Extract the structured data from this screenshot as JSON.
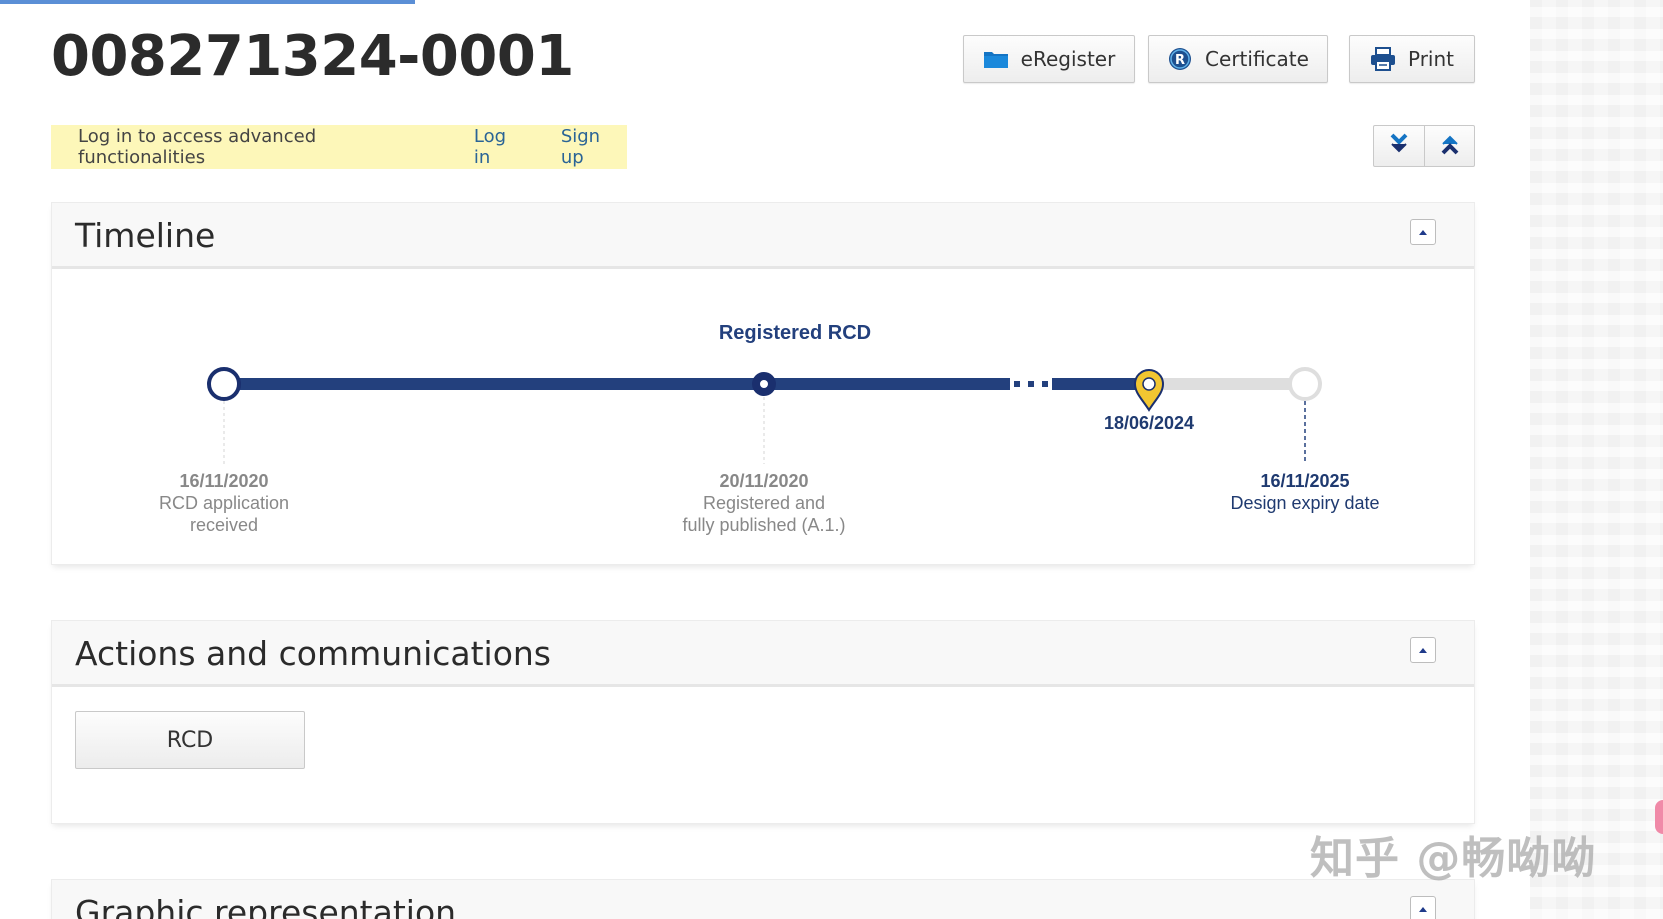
{
  "record": {
    "number": "008271324-0001"
  },
  "toolbar": {
    "eregister_label": "eRegister",
    "certificate_label": "Certificate",
    "print_label": "Print"
  },
  "login_banner": {
    "message": "Log in to access advanced functionalities",
    "login_label": "Log in",
    "signup_label": "Sign up"
  },
  "timeline": {
    "title": "Timeline",
    "status": "Registered RCD",
    "events": [
      {
        "date": "16/11/2020",
        "line1": "RCD application",
        "line2": "received"
      },
      {
        "date": "20/11/2020",
        "line1": "Registered and",
        "line2": "fully published (A.1.)"
      },
      {
        "date": "18/06/2024",
        "line1": "",
        "line2": ""
      },
      {
        "date": "16/11/2025",
        "line1": "Design expiry date",
        "line2": ""
      }
    ],
    "colors": {
      "active": "#23407d",
      "inactive": "#dedede",
      "marker": "#f2c631"
    }
  },
  "actions": {
    "title": "Actions and communications",
    "rcd_label": "RCD"
  },
  "graphic": {
    "title": "Graphic representation"
  },
  "watermark": {
    "text": "知乎 @畅呦呦"
  },
  "icons": [
    "folder-icon",
    "registered-icon",
    "printer-icon",
    "expand-all-icon",
    "collapse-all-icon",
    "collapse-panel-icon"
  ]
}
